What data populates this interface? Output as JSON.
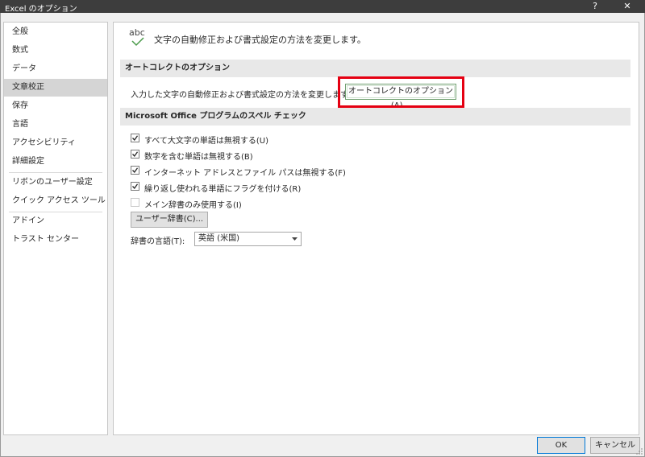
{
  "window": {
    "title": "Excel のオプション",
    "help_glyph": "?",
    "close_glyph": "✕"
  },
  "sidebar": {
    "items": [
      {
        "label": "全般"
      },
      {
        "label": "数式"
      },
      {
        "label": "データ"
      },
      {
        "label": "文章校正",
        "selected": true
      },
      {
        "label": "保存"
      },
      {
        "label": "言語"
      },
      {
        "label": "アクセシビリティ"
      },
      {
        "label": "詳細設定"
      },
      {
        "label": "リボンのユーザー設定"
      },
      {
        "label": "クイック アクセス ツール バー"
      },
      {
        "label": "アドイン"
      },
      {
        "label": "トラスト センター"
      }
    ]
  },
  "main": {
    "icon_text": "abc",
    "header": "文字の自動修正および書式設定の方法を変更します。",
    "autocorrect_section": {
      "title": "オートコレクトのオプション",
      "description": "入力した文字の自動修正および書式設定の方法を変更します:",
      "button_label": "オートコレクトのオプション(A)..."
    },
    "spelling_section": {
      "title": "Microsoft Office プログラムのスペル チェック",
      "options": [
        {
          "label": "すべて大文字の単語は無視する(U)",
          "checked": true
        },
        {
          "label": "数字を含む単語は無視する(B)",
          "checked": true
        },
        {
          "label": "インターネット アドレスとファイル パスは無視する(F)",
          "checked": true
        },
        {
          "label": "繰り返し使われる単語にフラグを付ける(R)",
          "checked": true
        },
        {
          "label": "メイン辞書のみ使用する(I)",
          "checked": false
        }
      ],
      "custom_dict_button": "ユーザー辞書(C)...",
      "dict_language_label": "辞書の言語(T):",
      "dict_language_value": "英語 (米国)"
    }
  },
  "footer": {
    "ok_label": "OK",
    "cancel_label": "キャンセル"
  },
  "colors": {
    "titlebar": "#3d3d3d",
    "highlight_box": "#e50012",
    "selected_item": "#d5d5d5",
    "check_accent": "#4a9a4a"
  }
}
